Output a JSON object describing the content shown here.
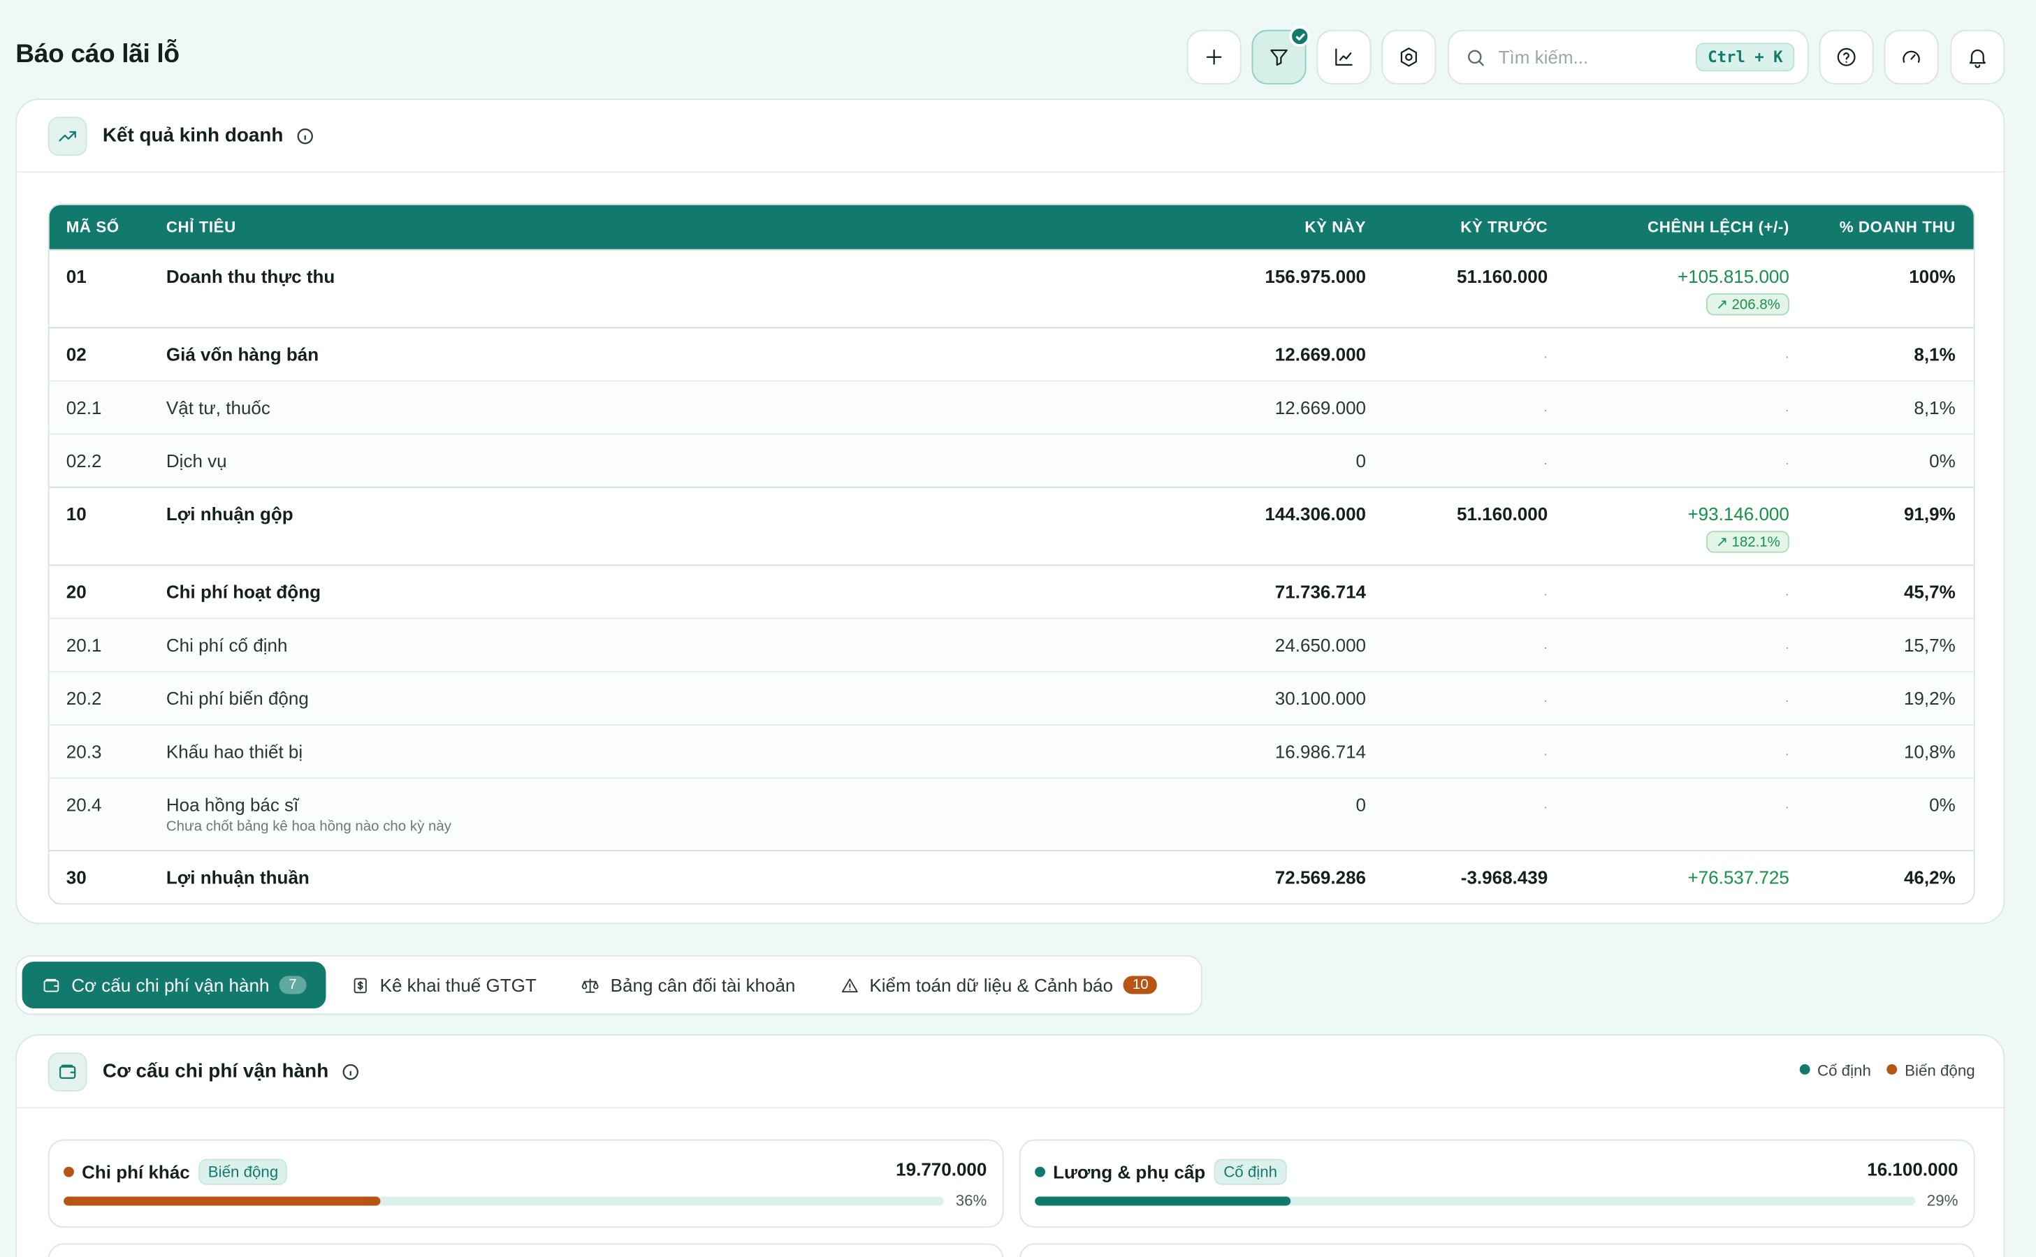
{
  "header": {
    "title": "Báo cáo lãi lỗ",
    "search_placeholder": "Tìm kiếm...",
    "search_shortcut": "Ctrl + K",
    "buttons": [
      "plus-icon",
      "filter-icon",
      "chart-icon",
      "settings-icon",
      "help-icon",
      "gauge-icon",
      "bell-icon"
    ]
  },
  "results": {
    "title": "Kết quả kinh doanh",
    "columns": [
      "MÃ SỐ",
      "CHỈ TIÊU",
      "KỲ NÀY",
      "KỲ TRƯỚC",
      "CHÊNH LỆCH (+/-)",
      "% DOANH THU"
    ],
    "rows": [
      {
        "code": "01",
        "name": "Doanh thu thực thu",
        "current": "156.975.000",
        "previous": "51.160.000",
        "diff": "+105.815.000",
        "diff_pct": "206.8%",
        "pct": "100%",
        "type": "major"
      },
      {
        "code": "02",
        "name": "Giá vốn hàng bán",
        "current": "12.669.000",
        "previous": "·",
        "diff": "·",
        "diff_pct": "",
        "pct": "8,1%",
        "type": "major"
      },
      {
        "code": "02.1",
        "name": "Vật tư, thuốc",
        "current": "12.669.000",
        "previous": "·",
        "diff": "·",
        "diff_pct": "",
        "pct": "8,1%",
        "type": "sub"
      },
      {
        "code": "02.2",
        "name": "Dịch vụ",
        "current": "0",
        "previous": "·",
        "diff": "·",
        "diff_pct": "",
        "pct": "0%",
        "type": "sub"
      },
      {
        "code": "10",
        "name": "Lợi nhuận gộp",
        "current": "144.306.000",
        "previous": "51.160.000",
        "diff": "+93.146.000",
        "diff_pct": "182.1%",
        "pct": "91,9%",
        "type": "major"
      },
      {
        "code": "20",
        "name": "Chi phí hoạt động",
        "current": "71.736.714",
        "previous": "·",
        "diff": "·",
        "diff_pct": "",
        "pct": "45,7%",
        "type": "major"
      },
      {
        "code": "20.1",
        "name": "Chi phí cố định",
        "current": "24.650.000",
        "previous": "·",
        "diff": "·",
        "diff_pct": "",
        "pct": "15,7%",
        "type": "sub"
      },
      {
        "code": "20.2",
        "name": "Chi phí biến động",
        "current": "30.100.000",
        "previous": "·",
        "diff": "·",
        "diff_pct": "",
        "pct": "19,2%",
        "type": "sub"
      },
      {
        "code": "20.3",
        "name": "Khấu hao thiết bị",
        "current": "16.986.714",
        "previous": "·",
        "diff": "·",
        "diff_pct": "",
        "pct": "10,8%",
        "type": "sub"
      },
      {
        "code": "20.4",
        "name": "Hoa hồng bác sĩ",
        "note": "Chưa chốt bảng kê hoa hồng nào cho kỳ này",
        "current": "0",
        "previous": "·",
        "diff": "·",
        "diff_pct": "",
        "pct": "0%",
        "type": "sub"
      },
      {
        "code": "30",
        "name": "Lợi nhuận thuần",
        "current": "72.569.286",
        "previous": "-3.968.439",
        "diff": "+76.537.725",
        "diff_pct": "",
        "pct": "46,2%",
        "type": "major"
      }
    ]
  },
  "tabs": [
    {
      "label": "Cơ cấu chi phí vận hành",
      "count": "7",
      "icon": "wallet-icon",
      "active": true
    },
    {
      "label": "Kê khai thuế GTGT",
      "count": "",
      "icon": "receipt-icon",
      "active": false
    },
    {
      "label": "Bảng cân đối tài khoản",
      "count": "",
      "icon": "scale-icon",
      "active": false
    },
    {
      "label": "Kiểm toán dữ liệu & Cảnh báo",
      "count": "10",
      "icon": "warning-icon",
      "active": false
    }
  ],
  "cost_structure": {
    "title": "Cơ cấu chi phí vận hành",
    "legend": [
      {
        "label": "Cố định",
        "color": "#117a6c"
      },
      {
        "label": "Biến động",
        "color": "#b85514"
      }
    ],
    "items": [
      {
        "name": "Chi phí khác",
        "tag": "Biến động",
        "value": "19.770.000",
        "pct_label": "36%",
        "fraction": 0.36,
        "color": "#b85514"
      },
      {
        "name": "Lương & phụ cấp",
        "tag": "Cố định",
        "value": "16.100.000",
        "pct_label": "29%",
        "fraction": 0.29,
        "color": "#117a6c"
      }
    ]
  },
  "colors": {
    "primary": "#117a6c",
    "positive": "#15924a",
    "warning": "#b85514",
    "background": "#eef8f6"
  }
}
